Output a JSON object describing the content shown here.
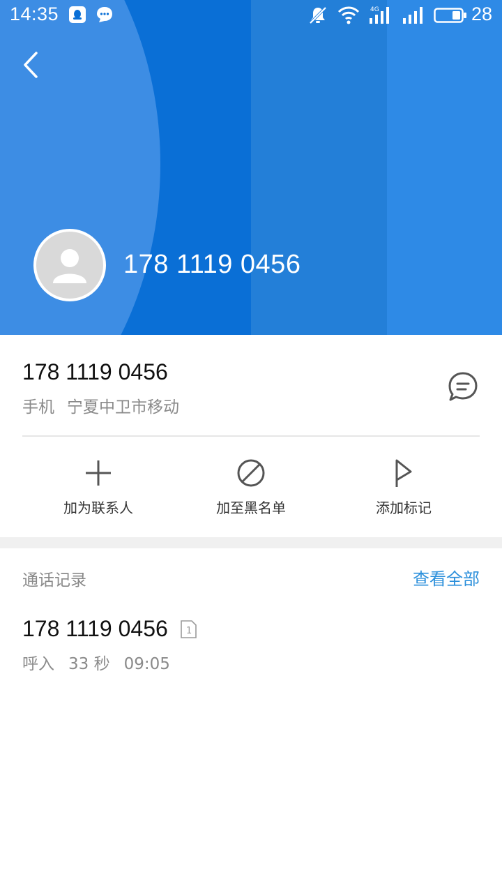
{
  "status_bar": {
    "time": "14:35",
    "battery": "28",
    "network": "4G",
    "icons": [
      "qq-icon",
      "chat-bubble-icon",
      "bell-muted-icon",
      "wifi-icon",
      "signal-4g-icon",
      "signal-icon",
      "battery-icon"
    ]
  },
  "header": {
    "phone_number": "178 1119 0456",
    "colors": {
      "primary": "#0a6fd6",
      "light": "#2e8ae6",
      "mid": "#237fd8",
      "circle": "#3d8de4"
    }
  },
  "info": {
    "phone_number": "178 1119 0456",
    "type": "手机",
    "location": "宁夏中卫市移动"
  },
  "actions": [
    {
      "label": "加为联系人",
      "icon": "plus-icon"
    },
    {
      "label": "加至黑名单",
      "icon": "block-icon"
    },
    {
      "label": "添加标记",
      "icon": "flag-icon"
    }
  ],
  "call_history": {
    "title": "通话记录",
    "view_all": "查看全部",
    "accent_color": "#2b8fdb",
    "records": [
      {
        "number": "178 1119 0456",
        "sim": "1",
        "direction": "呼入",
        "duration": "33 秒",
        "time": "09:05"
      }
    ]
  }
}
